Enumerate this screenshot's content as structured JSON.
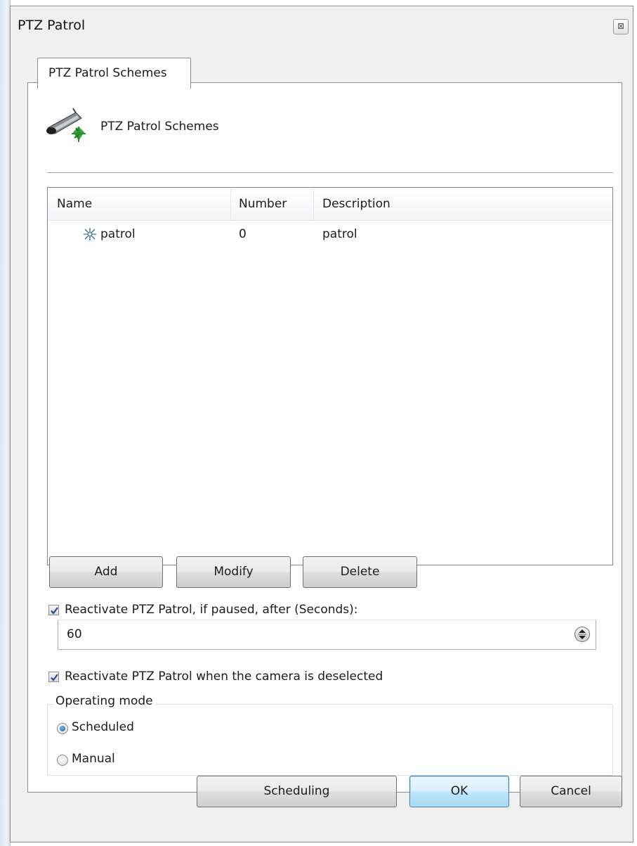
{
  "window": {
    "title": "PTZ Patrol",
    "close_label": "⊠"
  },
  "tab": {
    "label": "PTZ Patrol Schemes"
  },
  "header": {
    "title": "PTZ Patrol Schemes",
    "icon": "ptz-camera-icon"
  },
  "list": {
    "columns": [
      "Name",
      "Number",
      "Description"
    ],
    "rows": [
      {
        "name": "patrol",
        "number": "0",
        "description": "patrol",
        "icon": "patrol-scheme-icon"
      }
    ]
  },
  "list_buttons": {
    "add": "Add",
    "modify": "Modify",
    "delete": "Delete"
  },
  "reactivate_paused": {
    "label": "Reactivate PTZ Patrol, if paused, after (Seconds):",
    "checked": true,
    "value": "60"
  },
  "reactivate_deselected": {
    "label": "Reactivate PTZ Patrol when the camera is deselected",
    "checked": true
  },
  "operating_mode": {
    "legend": "Operating mode",
    "options": [
      {
        "label": "Scheduled",
        "selected": true
      },
      {
        "label": "Manual",
        "selected": false
      }
    ]
  },
  "footer": {
    "scheduling": "Scheduling",
    "ok": "OK",
    "cancel": "Cancel"
  }
}
